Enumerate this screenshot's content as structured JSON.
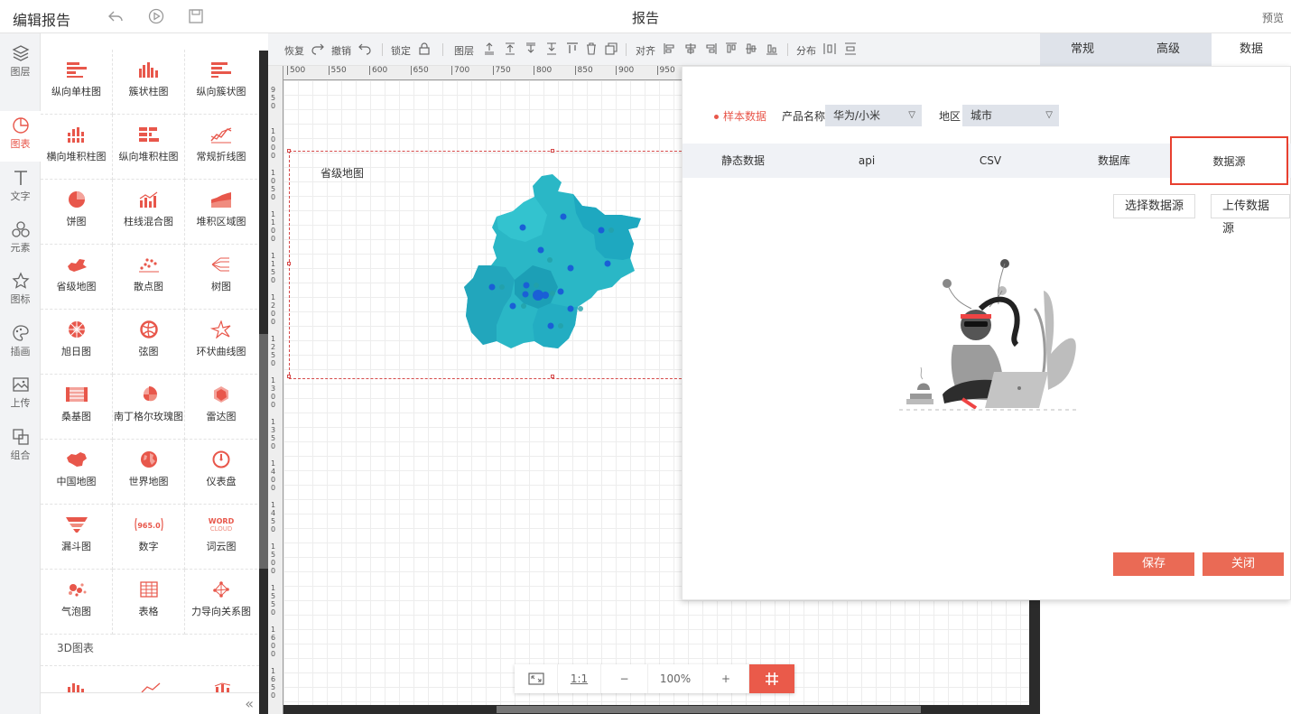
{
  "app": {
    "title": "编辑报告",
    "center_title": "报告",
    "preview_label": "预览"
  },
  "rail": [
    {
      "label": "图层",
      "icon": "layers-icon"
    },
    {
      "label": "图表",
      "icon": "chart-icon",
      "active": true
    },
    {
      "label": "文字",
      "icon": "text-icon"
    },
    {
      "label": "元素",
      "icon": "elements-icon"
    },
    {
      "label": "图标",
      "icon": "star-icon"
    },
    {
      "label": "插画",
      "icon": "palette-icon"
    },
    {
      "label": "上传",
      "icon": "image-upload-icon"
    },
    {
      "label": "组合",
      "icon": "group-icon"
    }
  ],
  "library": {
    "items": [
      "纵向单柱图",
      "簇状柱图",
      "纵向簇状图",
      "横向堆积柱图",
      "纵向堆积柱图",
      "常规折线图",
      "饼图",
      "柱线混合图",
      "堆积区域图",
      "省级地图",
      "散点图",
      "树图",
      "旭日图",
      "弦图",
      "环状曲线图",
      "桑基图",
      "南丁格尔玫瑰图",
      "雷达图",
      "中国地图",
      "世界地图",
      "仪表盘",
      "漏斗图",
      "数字",
      "词云图",
      "气泡图",
      "表格",
      "力导向关系图"
    ],
    "section_3d": "3D图表",
    "number_sample": "965.0",
    "wordcloud_sample_1": "WORD",
    "wordcloud_sample_2": "CLOUD"
  },
  "toolbar": {
    "redo": "恢复",
    "undo": "撤销",
    "lock": "锁定",
    "layer": "图层",
    "align": "对齐",
    "distribute": "分布"
  },
  "ruler": {
    "top": [
      "500",
      "550",
      "600",
      "650",
      "700",
      "750",
      "800",
      "850",
      "900",
      "950"
    ],
    "left": [
      "950",
      "1000",
      "1050",
      "1100",
      "1150",
      "1200",
      "1250",
      "1300",
      "1350",
      "1400",
      "1450",
      "1500",
      "1550",
      "1600",
      "1650"
    ]
  },
  "canvas": {
    "map_title": "省级地图",
    "colors": {
      "map_fill": "#2ab7c6",
      "map_dark": "#1e9fb5",
      "dot": "#1a5fd6"
    }
  },
  "zoom": {
    "fit_label": "fit-screen-icon",
    "one_to_one": "1:1",
    "minus": "−",
    "value": "100%",
    "plus": "+",
    "grid_label": "#"
  },
  "rpanel": {
    "tabs": [
      "常规",
      "高级",
      "数据"
    ],
    "active_tab": "数据"
  },
  "dialog": {
    "sample_data": "样本数据",
    "product_label": "产品名称",
    "product_value": "华为/小米",
    "region_label": "地区",
    "region_value": "城市",
    "tabs": [
      "静态数据",
      "api",
      "CSV",
      "数据库",
      "数据源"
    ],
    "selected_tab": "数据源",
    "select_source": "选择数据源",
    "upload_source": "上传数据源",
    "save": "保存",
    "close": "关闭",
    "accent": "#e8574b"
  }
}
